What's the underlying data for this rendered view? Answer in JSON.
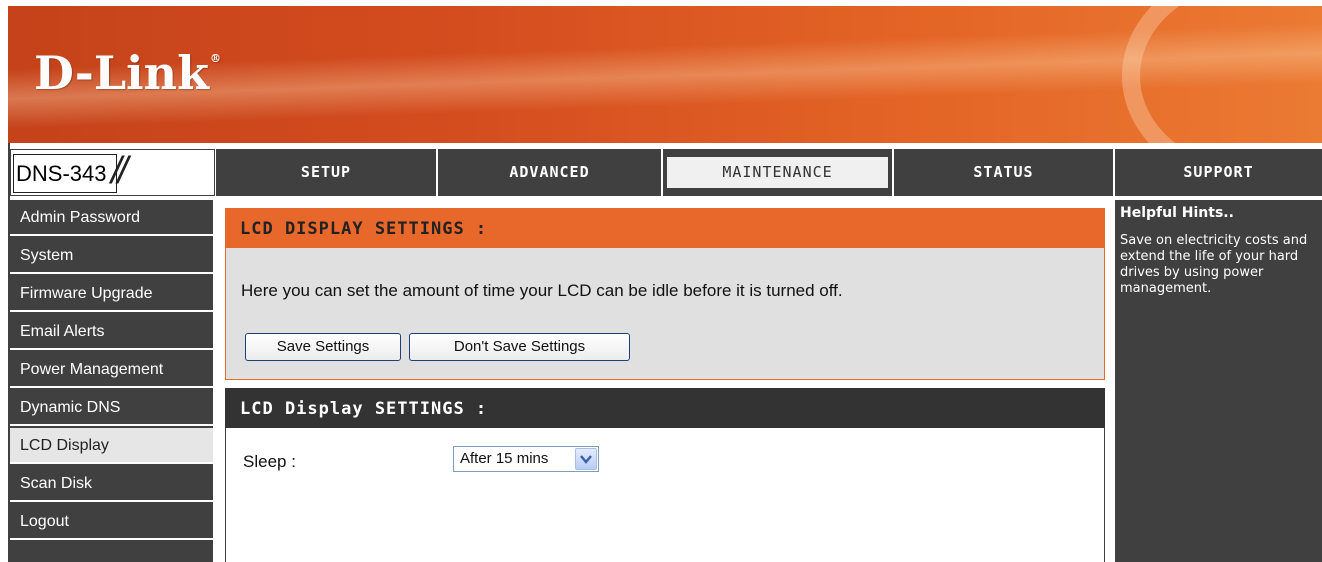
{
  "brand": {
    "logo_text": "D-Link",
    "logo_mark": "®"
  },
  "model": {
    "name": "DNS-343",
    "slashes": "//"
  },
  "nav": {
    "tabs": [
      {
        "label": "SETUP",
        "active": false
      },
      {
        "label": "ADVANCED",
        "active": false
      },
      {
        "label": "MAINTENANCE",
        "active": true
      },
      {
        "label": "STATUS",
        "active": false
      },
      {
        "label": "SUPPORT",
        "active": false
      }
    ]
  },
  "sidebar": {
    "items": [
      {
        "label": "Admin Password",
        "active": false
      },
      {
        "label": "System",
        "active": false
      },
      {
        "label": "Firmware Upgrade",
        "active": false
      },
      {
        "label": "Email Alerts",
        "active": false
      },
      {
        "label": "Power Management",
        "active": false
      },
      {
        "label": "Dynamic DNS",
        "active": false
      },
      {
        "label": "LCD Display",
        "active": true
      },
      {
        "label": "Scan Disk",
        "active": false
      },
      {
        "label": "Logout",
        "active": false
      }
    ]
  },
  "main": {
    "panel1": {
      "title": "LCD DISPLAY SETTINGS :",
      "description": "Here you can set the amount of time your LCD can be idle before it is turned off.",
      "save_label": "Save Settings",
      "dont_save_label": "Don't Save Settings"
    },
    "panel2": {
      "title": "LCD Display SETTINGS :",
      "sleep_label": "Sleep :",
      "sleep_value": "After 15 mins"
    }
  },
  "hints": {
    "title": "Helpful Hints..",
    "text": "Save on electricity costs and extend the life of your hard drives by using power management."
  },
  "colors": {
    "banner_orange": "#d44d1f",
    "header_orange": "#e8672a",
    "dark_gray": "#404040",
    "panel_gray": "#e0e0e0"
  }
}
